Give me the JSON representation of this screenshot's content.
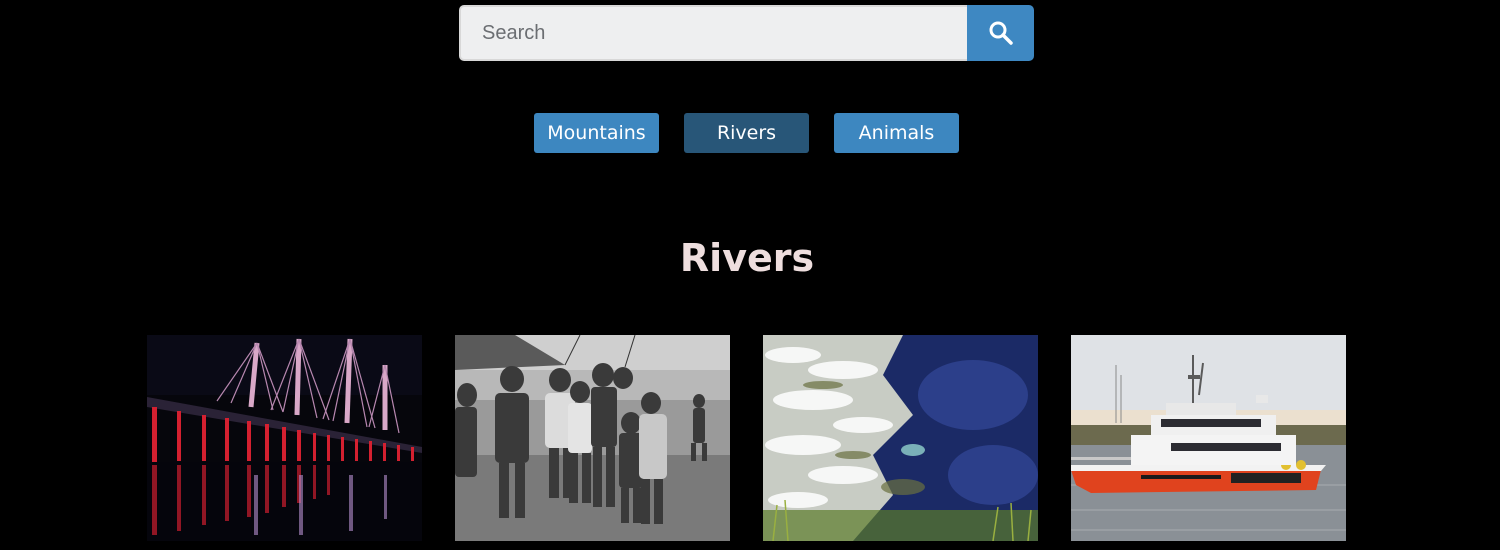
{
  "search": {
    "placeholder": "Search",
    "button_icon": "magnifier-icon"
  },
  "categories": [
    {
      "label": "Mountains",
      "active": false
    },
    {
      "label": "Rivers",
      "active": true
    },
    {
      "label": "Animals",
      "active": false
    }
  ],
  "section": {
    "title": "Rivers"
  },
  "gallery": {
    "photos": [
      {
        "subject": "illuminated cable-stayed bridge at night over a river"
      },
      {
        "subject": "black and white photo of children standing on a riverbank"
      },
      {
        "subject": "river rapids with white water and blue pool"
      },
      {
        "subject": "orange and white catamaran boat on a river"
      }
    ]
  },
  "colors": {
    "background": "#000000",
    "accent": "#3e88c2",
    "active_button": "#285678",
    "title": "#eedede"
  }
}
